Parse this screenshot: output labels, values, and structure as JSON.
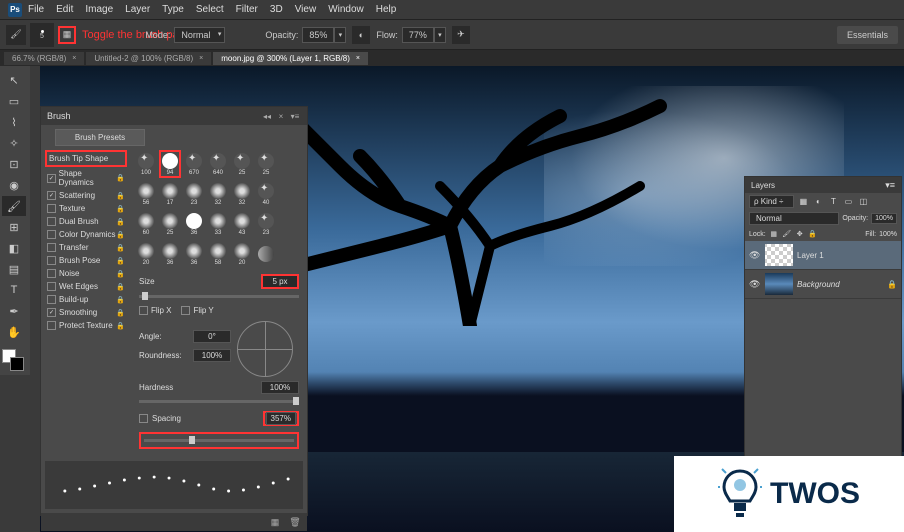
{
  "menu": {
    "items": [
      "File",
      "Edit",
      "Image",
      "Layer",
      "Type",
      "Select",
      "Filter",
      "3D",
      "View",
      "Window",
      "Help"
    ]
  },
  "options": {
    "brush_size": "5",
    "mode_label": "Mode:",
    "mode_value": "Normal",
    "opacity_label": "Opacity:",
    "opacity_value": "85%",
    "flow_label": "Flow:",
    "flow_value": "77%",
    "annotation_text": "Toggle the brush panel",
    "essentials": "Essentials"
  },
  "tabs": [
    {
      "label": "66.7% (RGB/8)",
      "active": false
    },
    {
      "label": "Untitled-2 @ 100% (RGB/8)",
      "active": false
    },
    {
      "label": "moon.jpg @ 300% (Layer 1, RGB/8)",
      "active": true
    }
  ],
  "brush_panel": {
    "title": "Brush",
    "presets_btn": "Brush Presets",
    "tip_shape": "Brush Tip Shape",
    "options": [
      {
        "label": "Shape Dynamics",
        "checked": true
      },
      {
        "label": "Scattering",
        "checked": true
      },
      {
        "label": "Texture",
        "checked": false
      },
      {
        "label": "Dual Brush",
        "checked": false
      },
      {
        "label": "Color Dynamics",
        "checked": false
      },
      {
        "label": "Transfer",
        "checked": false
      },
      {
        "label": "Brush Pose",
        "checked": false
      },
      {
        "label": "Noise",
        "checked": false
      },
      {
        "label": "Wet Edges",
        "checked": false
      },
      {
        "label": "Build-up",
        "checked": false
      },
      {
        "label": "Smoothing",
        "checked": true
      },
      {
        "label": "Protect Texture",
        "checked": false
      }
    ],
    "brushes_row1": [
      "100",
      "94",
      "670",
      "640",
      "25",
      "25"
    ],
    "brushes_row2": [
      "56",
      "17",
      "23",
      "32",
      "32",
      "40"
    ],
    "brushes_row3": [
      "60",
      "25",
      "36",
      "33",
      "43",
      "23"
    ],
    "brushes_row4": [
      "20",
      "36",
      "36",
      "58",
      "20",
      ""
    ],
    "highlighted_brush_index": 1,
    "size_label": "Size",
    "size_value": "5 px",
    "flipx_label": "Flip X",
    "flipy_label": "Flip Y",
    "angle_label": "Angle:",
    "angle_value": "0°",
    "roundness_label": "Roundness:",
    "roundness_value": "100%",
    "hardness_label": "Hardness",
    "hardness_value": "100%",
    "spacing_label": "Spacing",
    "spacing_value": "357%"
  },
  "layers_panel": {
    "title": "Layers",
    "kind": "Kind",
    "blend_mode": "Normal",
    "opacity_label": "Opacity:",
    "opacity_value": "100%",
    "lock_label": "Lock:",
    "fill_label": "Fill:",
    "fill_value": "100%",
    "layers": [
      {
        "name": "Layer 1",
        "visible": true,
        "bg": false
      },
      {
        "name": "Background",
        "visible": true,
        "bg": true
      }
    ]
  },
  "watermark": {
    "text": "TWOS"
  }
}
